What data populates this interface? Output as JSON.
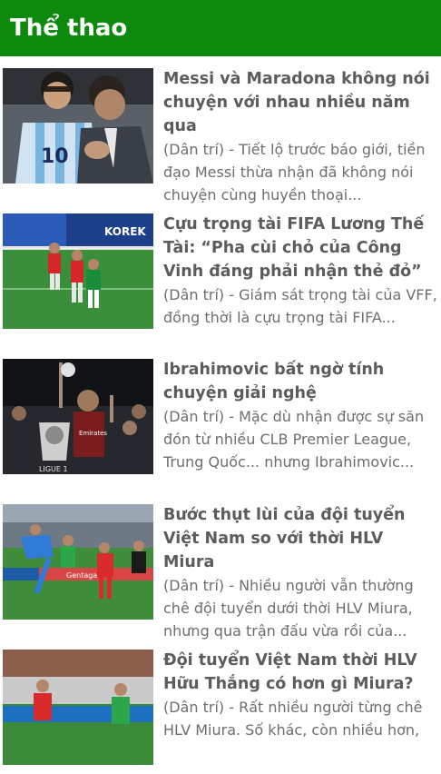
{
  "header": {
    "title": "Thể thao"
  },
  "articles": [
    {
      "title": "Messi và Maradona không nói chuyện với nhau nhiều năm qua",
      "summary": "(Dân trí) - Tiết lộ trước báo giới, tiền đạo Messi thừa nhận đã không nói chuyện cùng huyền thoại...",
      "jersey_number": "10"
    },
    {
      "title": "Cựu trọng tài FIFA Lương Thế Tài: “Pha cùi chỏ của Công Vinh đáng phải nhận thẻ đỏ”",
      "summary": "(Dân trí) - Giám sát trọng tài của VFF, đồng thời là cựu trọng tài FIFA...",
      "banner_text": "KOREK"
    },
    {
      "title": "Ibrahimovic bất ngờ tính chuyện giải nghệ",
      "summary": "(Dân trí) - Mặc dù nhận được sự săn đón từ nhiều CLB Premier League, Trung Quốc... nhưng Ibrahimovic...",
      "shirt_text": "Emirates",
      "trophy_text": "LIGUE 1"
    },
    {
      "title": "Bước thụt lùi của đội tuyển Việt Nam so với thời HLV Miura",
      "summary": "(Dân trí) - Nhiều người vẫn thường chê đội tuyển dưới thời HLV Miura, nhưng qua trận đấu vừa rồi của...",
      "banner_text": "Gentaga"
    },
    {
      "title": "Đội tuyển Việt Nam thời HLV Hữu Thắng có hơn gì Miura?",
      "summary": "(Dân trí) - Rất nhiều người từng chê HLV Miura. Số khác, còn nhiều hơn,"
    }
  ]
}
